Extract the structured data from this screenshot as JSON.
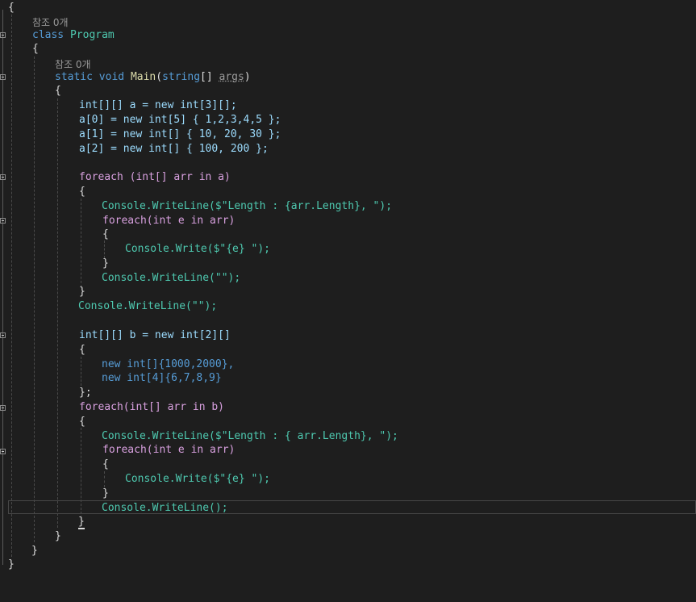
{
  "editor": {
    "codelens_refs": "참조 0개",
    "lines": {
      "l01": "{",
      "l03_kw": "class",
      "l03_name": "Program",
      "l04": "{",
      "l06_static": "static",
      "l06_void": "void",
      "l06_name": "Main",
      "l06_open": "(",
      "l06_string": "string",
      "l06_rest": "[] ",
      "l06_args": "args",
      "l06_close": ")",
      "l07": "{",
      "l08": "int[][] a = new int[3][];",
      "l09": "a[0] = new int[5] { 1,2,3,4,5 };",
      "l10": "a[1] = new int[] { 10, 20, 30 };",
      "l11": "a[2] = new int[] { 100, 200 };",
      "l13": "foreach (int[] arr in a)",
      "l14": "{",
      "l15": "Console.WriteLine($\"Length : {arr.Length}, \");",
      "l16": "foreach(int e in arr)",
      "l17": "{",
      "l18": "Console.Write($\"{e} \");",
      "l19": "}",
      "l20": "Console.WriteLine(\"\");",
      "l21": "}",
      "l22": "Console.WriteLine(\"\");",
      "l24": "int[][] b = new int[2][]",
      "l25": "{",
      "l26": "new int[]{1000,2000},",
      "l27": "new int[4]{6,7,8,9}",
      "l28": "};",
      "l29": "foreach(int[] arr in b)",
      "l30": "{",
      "l31": "Console.WriteLine($\"Length : { arr.Length}, \");",
      "l32": "foreach(int e in arr)",
      "l33": "{",
      "l34": "Console.Write($\"{e} \");",
      "l35": "}",
      "l36": "Console.WriteLine();",
      "l37": "}",
      "l38": "}",
      "l39": "}",
      "l40": "}"
    }
  },
  "colors": {
    "background": "#1e1e1e",
    "keyword": "#569cd6",
    "control": "#d8a0df",
    "type": "#4ec9b0",
    "method": "#dcdcaa",
    "string": "#d69d85",
    "number": "#b5cea8",
    "variable": "#9cdcfe",
    "text": "#dcdcdc"
  }
}
